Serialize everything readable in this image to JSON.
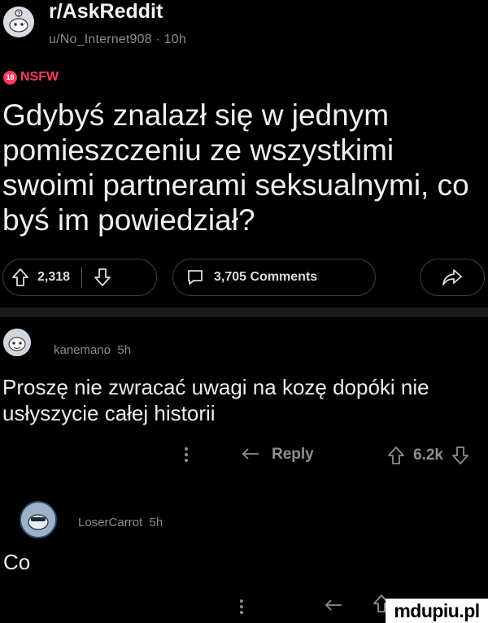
{
  "post": {
    "subreddit": "r/AskReddit",
    "meta": "u/No_Internet908 · 10h",
    "nsfw_icon_text": "18",
    "nsfw_label": "NSFW",
    "title": "Gdybyś znalazł się w jednym pomieszczeniu ze wszystkimi swoimi partnerami seksualnymi, co byś im powiedział?",
    "upvotes": "2,318",
    "comments_label": "3,705 Comments"
  },
  "comments": [
    {
      "user": "kanemano",
      "age": "5h",
      "text": "Proszę nie zwracać uwagi na kozę dopóki nie usłyszycie całej historii",
      "reply_label": "Reply",
      "votes": "6.2k"
    },
    {
      "user": "LoserCarrot",
      "age": "5h",
      "text": "Co"
    }
  ],
  "watermark": "mdupiu.pl",
  "colors": {
    "background": "#000000",
    "nsfw": "#ff3b5c",
    "text": "#ececec",
    "muted": "#8d8d8d"
  },
  "icons": [
    "subreddit-avatar",
    "nsfw-icon",
    "upvote-icon",
    "downvote-icon",
    "comment-icon",
    "share-icon",
    "more-icon",
    "reply-icon"
  ]
}
